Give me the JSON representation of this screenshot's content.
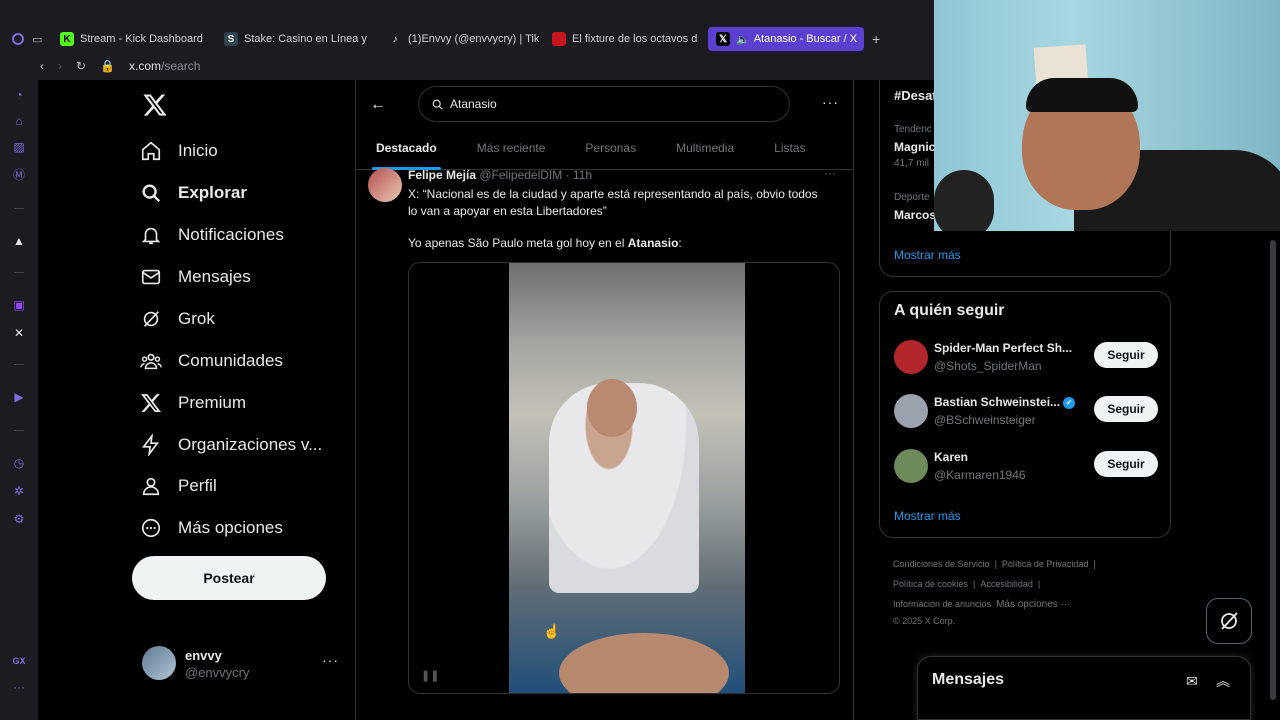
{
  "browser": {
    "tabs": [
      {
        "label": "Stream - Kick Dashboard",
        "icon": "kick-icon",
        "color": "#53fc18"
      },
      {
        "label": "Stake: Casino en Línea y",
        "icon": "stake-icon",
        "color": "#2f4553"
      },
      {
        "label": "(1)Envvy (@envvycry) | Tik",
        "icon": "tiktok-icon",
        "color": "#000000"
      },
      {
        "label": "El fixture de los octavos d",
        "icon": "news-icon",
        "color": "#c4161c"
      },
      {
        "label": "Atanasio - Buscar / X",
        "icon": "x-icon",
        "color": "#000000"
      }
    ],
    "url_host": "x.com",
    "url_path": "/search"
  },
  "nav": {
    "items": [
      {
        "label": "Inicio",
        "icon": "home-icon"
      },
      {
        "label": "Explorar",
        "icon": "search-icon"
      },
      {
        "label": "Notificaciones",
        "icon": "bell-icon"
      },
      {
        "label": "Mensajes",
        "icon": "mail-icon"
      },
      {
        "label": "Grok",
        "icon": "grok-icon"
      },
      {
        "label": "Comunidades",
        "icon": "communities-icon"
      },
      {
        "label": "Premium",
        "icon": "x-premium-icon"
      },
      {
        "label": "Organizaciones v...",
        "icon": "lightning-icon"
      },
      {
        "label": "Perfil",
        "icon": "person-icon"
      },
      {
        "label": "Más opciones",
        "icon": "more-circle-icon"
      }
    ],
    "post_label": "Postear",
    "account": {
      "name": "envvy",
      "handle": "@envvycry"
    }
  },
  "search": {
    "value": "Atanasio",
    "tabs": [
      "Destacado",
      "Más reciente",
      "Personas",
      "Multimedia",
      "Listas"
    ]
  },
  "tweet": {
    "name": "Felipe Mejía",
    "handle": "@FelipedelDIM",
    "time": "· 11h",
    "text1": "X: “Nacional es de la ciudad y aparte está representando al país, obvio todos lo van a apoyar en esta Libertadores”",
    "text2_prefix": "Yo apenas São Paulo meta gol hoy en el ",
    "text2_bold": "Atanasio",
    "text2_suffix": ":"
  },
  "trends": {
    "header": "#Desat",
    "t1_meta": "Tendenc",
    "t1_name": "Magnic",
    "t1_count": "41,7 mil",
    "t2_meta": "Deporte",
    "t2_name": "Marcos",
    "show_more": "Mostrar más"
  },
  "follow": {
    "title": "A quién seguir",
    "button": "Seguir",
    "people": [
      {
        "name": "Spider-Man Perfect Sh...",
        "handle": "@Shots_SpiderMan",
        "avatar_color": "#b3262b"
      },
      {
        "name": "Bastian Schweinstei...",
        "handle": "@BSchweinsteiger",
        "avatar_color": "#9aa3ad",
        "verified": "✓"
      },
      {
        "name": "Karen",
        "handle": "@Karmaren1946",
        "avatar_color": "#6e8a5a"
      }
    ],
    "show_more": "Mostrar más"
  },
  "footer": {
    "links": [
      "Condiciones de Servicio",
      "|",
      "Política de Privacidad",
      "|",
      "Política de cookies",
      "|",
      "Accesibilidad",
      "|",
      "Información de anuncios",
      "Más opciones ···"
    ],
    "copyright": "© 2025 X Corp."
  },
  "messages": {
    "title": "Mensajes"
  },
  "colors": {
    "accent": "#1d9bf0",
    "browser_accent": "#5b3fd1"
  }
}
